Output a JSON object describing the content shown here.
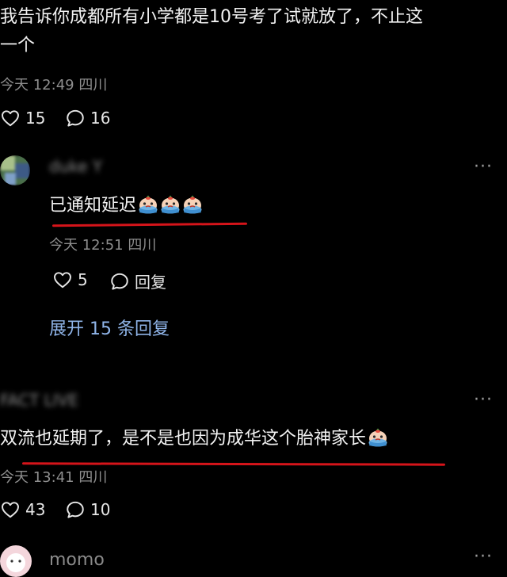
{
  "comment_top": {
    "text_line1": "我告诉你成都所有小学都是10号考了试就放了，不止这",
    "text_line2": "一个",
    "meta": "今天 12:49 四川",
    "likes": "15",
    "replies": "16"
  },
  "reply_1": {
    "username": "duke Y",
    "text": "已通知延迟",
    "meta": "今天 12:51 四川",
    "likes": "5",
    "reply_label": "回复"
  },
  "expand": {
    "label": "展开 15 条回复"
  },
  "comment_2": {
    "username": "FACT LIVE",
    "text": "双流也延期了，是不是也因为成华这个胎神家长",
    "meta": "今天 13:41 四川",
    "likes": "43",
    "replies": "10"
  },
  "comment_3": {
    "username": "momo"
  },
  "colors": {
    "background": "#000000",
    "underline": "#d5141a",
    "link": "#8fb4e8",
    "meta": "#8e8e8e"
  },
  "icons": [
    "heart-icon",
    "comment-bubble-icon",
    "more-dots-icon",
    "crying-emoji-icon"
  ]
}
